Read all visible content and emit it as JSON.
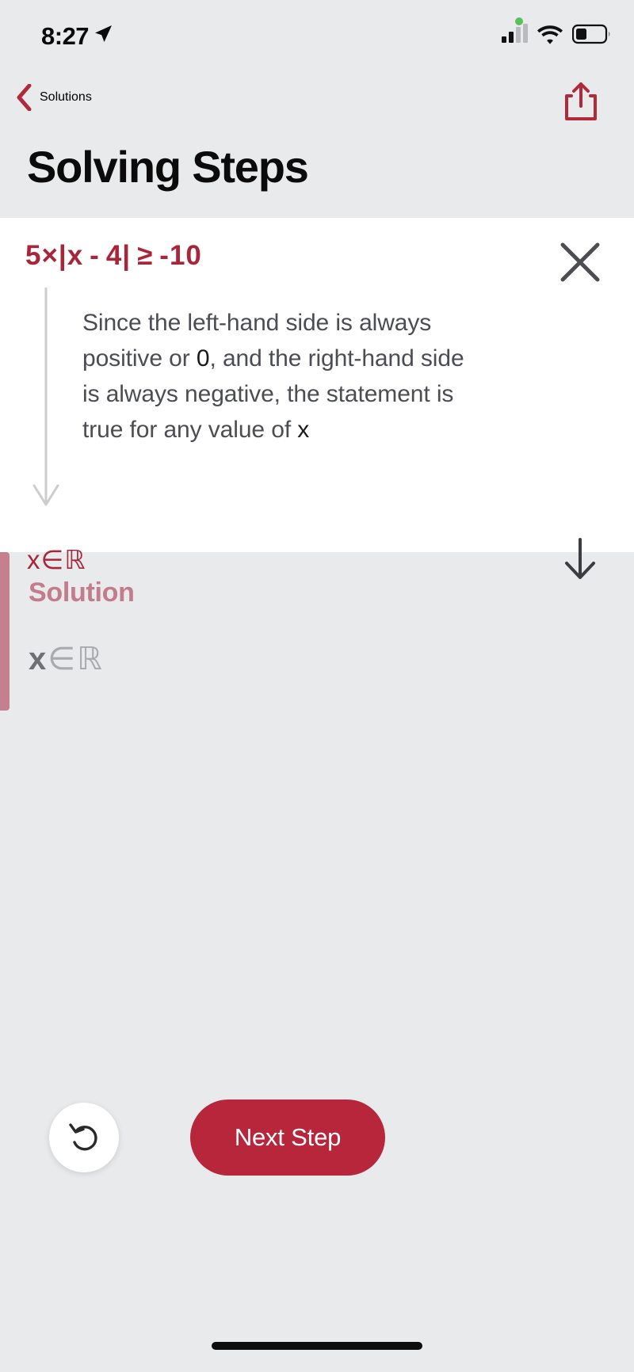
{
  "status_bar": {
    "time": "8:27",
    "location_icon": "location-arrow-icon",
    "recording_dot_color": "#5ac15a",
    "cellular_icon": "cellular-signal-icon",
    "wifi_icon": "wifi-icon",
    "battery_icon": "battery-low-icon"
  },
  "nav": {
    "back_label": "Solutions",
    "back_icon": "chevron-left-icon",
    "share_icon": "share-upload-icon",
    "accent_color": "#b02a3c"
  },
  "header": {
    "title": "Solving Steps"
  },
  "step": {
    "equation": "5×|x - 4| ≥ -10",
    "close_icon": "close-x-icon",
    "flow_arrow_icon": "down-arrow-connector-icon",
    "explanation_parts": [
      {
        "text": "Since the left-hand side is always positive or ",
        "kind": "prose"
      },
      {
        "text": "0",
        "kind": "math"
      },
      {
        "text": ", and the right-hand side is always negative, the statement is true for any value of ",
        "kind": "prose"
      },
      {
        "text": "x",
        "kind": "math"
      }
    ],
    "explanation_plain": "Since the left-hand side is always positive or 0, and the right-hand side is always negative, the statement is true for any value of x",
    "result": "x ∈ ℝ",
    "result_variable": "x",
    "result_member_symbol": "∈",
    "result_set_symbol": "ℝ",
    "expand_icon": "arrow-down-icon",
    "equation_color": "#a9263a"
  },
  "solution": {
    "label": "Solution",
    "value_variable": "x",
    "value_member_symbol": "∈",
    "value_set_symbol": "ℝ",
    "value": "x ∈ ℝ",
    "accent_color": "#c4808e"
  },
  "bottom": {
    "undo_icon": "undo-arrow-icon",
    "next_step_label": "Next Step",
    "next_step_color": "#b8263c",
    "home_indicator": "home-indicator"
  }
}
